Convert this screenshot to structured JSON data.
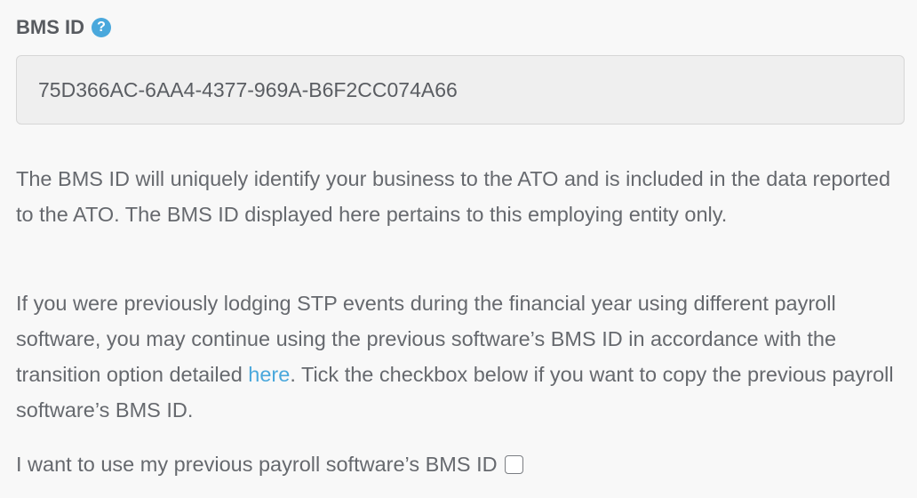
{
  "bms": {
    "label": "BMS ID",
    "help_icon": "question-circle-icon",
    "value": "75D366AC-6AA4-4377-969A-B6F2CC074A66"
  },
  "info": {
    "paragraph1": "The BMS ID will uniquely identify your business to the ATO and is included in the data reported to the ATO. The BMS ID displayed here pertains to this employing entity only.",
    "paragraph2_before_link": "If you were previously lodging STP events during the financial year using different payroll software, you may continue using the previous software’s BMS ID in accordance with the transition option detailed ",
    "link_text": "here",
    "paragraph2_after_link": ". Tick the checkbox below if you want to copy the previous payroll software’s BMS ID."
  },
  "checkbox": {
    "label": "I want to use my previous payroll software’s BMS ID",
    "checked": false
  },
  "colors": {
    "accent": "#4aa8dc",
    "text": "#66696e",
    "field_bg": "#efefef",
    "page_bg": "#f8f8f8"
  }
}
